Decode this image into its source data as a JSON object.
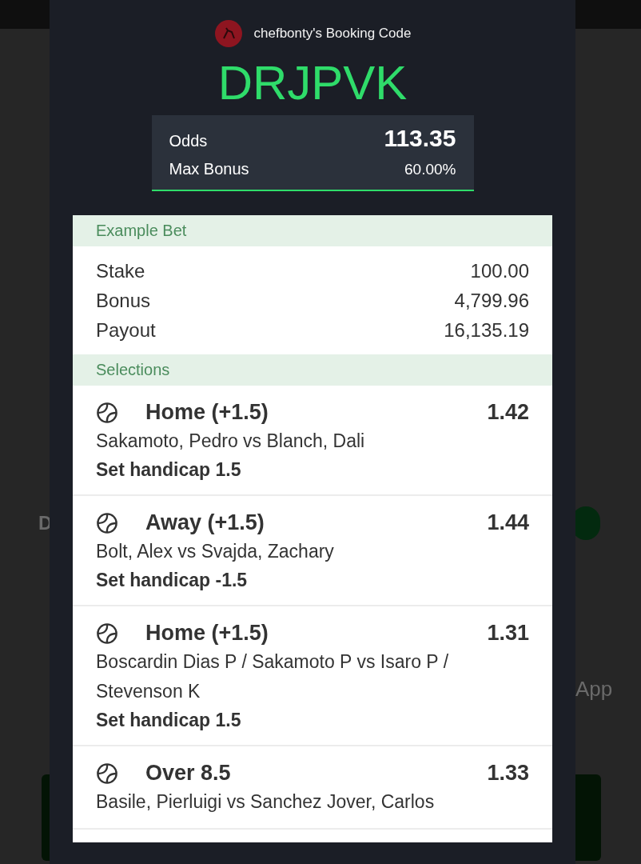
{
  "background": {
    "texts": [
      "D",
      "App"
    ]
  },
  "header": {
    "title": "chefbonty's Booking Code",
    "code": "DRJPVK"
  },
  "summary": {
    "odds_label": "Odds",
    "odds": "113.35",
    "bonus_label": "Max Bonus",
    "bonus": "60.00%"
  },
  "example": {
    "heading": "Example Bet",
    "rows": [
      {
        "label": "Stake",
        "value": "100.00"
      },
      {
        "label": "Bonus",
        "value": "4,799.96"
      },
      {
        "label": "Payout",
        "value": "16,135.19"
      }
    ]
  },
  "selections": {
    "heading": "Selections",
    "items": [
      {
        "pick": "Home (+1.5)",
        "odds": "1.42",
        "match": "Sakamoto, Pedro vs Blanch, Dali",
        "market": "Set handicap 1.5"
      },
      {
        "pick": "Away (+1.5)",
        "odds": "1.44",
        "match": "Bolt, Alex vs Svajda, Zachary",
        "market": "Set handicap -1.5"
      },
      {
        "pick": "Home (+1.5)",
        "odds": "1.31",
        "match": "Boscardin Dias P / Sakamoto P vs Isaro P / Stevenson K",
        "market": "Set handicap 1.5"
      },
      {
        "pick": "Over 8.5",
        "odds": "1.33",
        "match": "Basile, Pierluigi vs Sanchez Jover, Carlos"
      }
    ]
  }
}
